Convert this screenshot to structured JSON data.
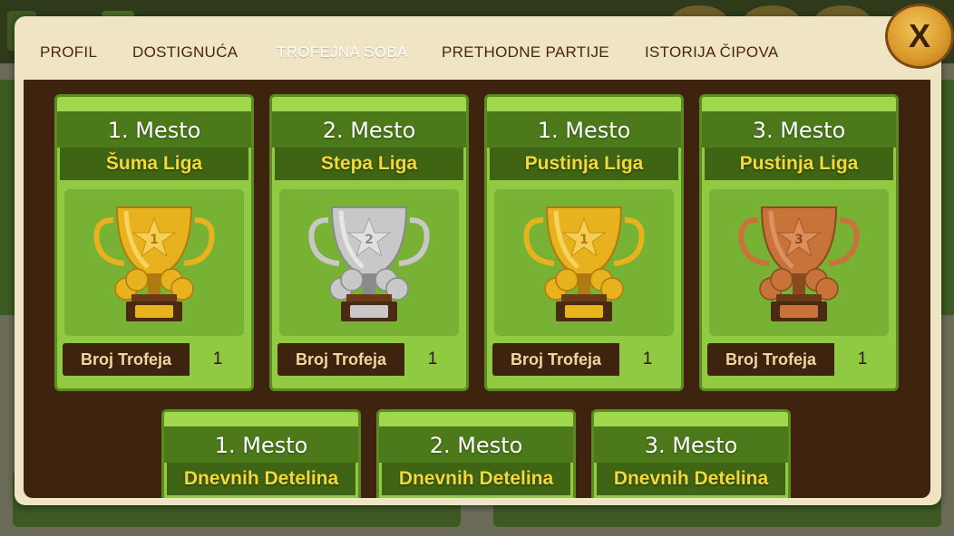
{
  "tabs": [
    {
      "label": "PROFIL",
      "active": false
    },
    {
      "label": "DOSTIGNUĆA",
      "active": false
    },
    {
      "label": "TROFEJNA SOBA",
      "active": true
    },
    {
      "label": "PRETHODNE PARTIJE",
      "active": false
    },
    {
      "label": "ISTORIJA ČIPOVA",
      "active": false
    }
  ],
  "close_label": "X",
  "count_label": "Broj Trofeja",
  "trophies": [
    {
      "place": "1. Mesto",
      "league": "Šuma Liga",
      "count": "1",
      "medal": "gold",
      "rank": "1"
    },
    {
      "place": "2. Mesto",
      "league": "Stepa Liga",
      "count": "1",
      "medal": "silver",
      "rank": "2"
    },
    {
      "place": "1. Mesto",
      "league": "Pustinja Liga",
      "count": "1",
      "medal": "gold",
      "rank": "1"
    },
    {
      "place": "3. Mesto",
      "league": "Pustinja Liga",
      "count": "1",
      "medal": "bronze",
      "rank": "3"
    }
  ],
  "daily": [
    {
      "place": "1. Mesto",
      "league": "Dnevnih Detelina"
    },
    {
      "place": "2. Mesto",
      "league": "Dnevnih Detelina"
    },
    {
      "place": "3. Mesto",
      "league": "Dnevnih Detelina"
    }
  ],
  "colors": {
    "gold": "#e8b21e",
    "silver": "#c8c8c8",
    "bronze": "#c8733a",
    "card_bg": "#8fca42",
    "league_text": "#f3d83a"
  }
}
